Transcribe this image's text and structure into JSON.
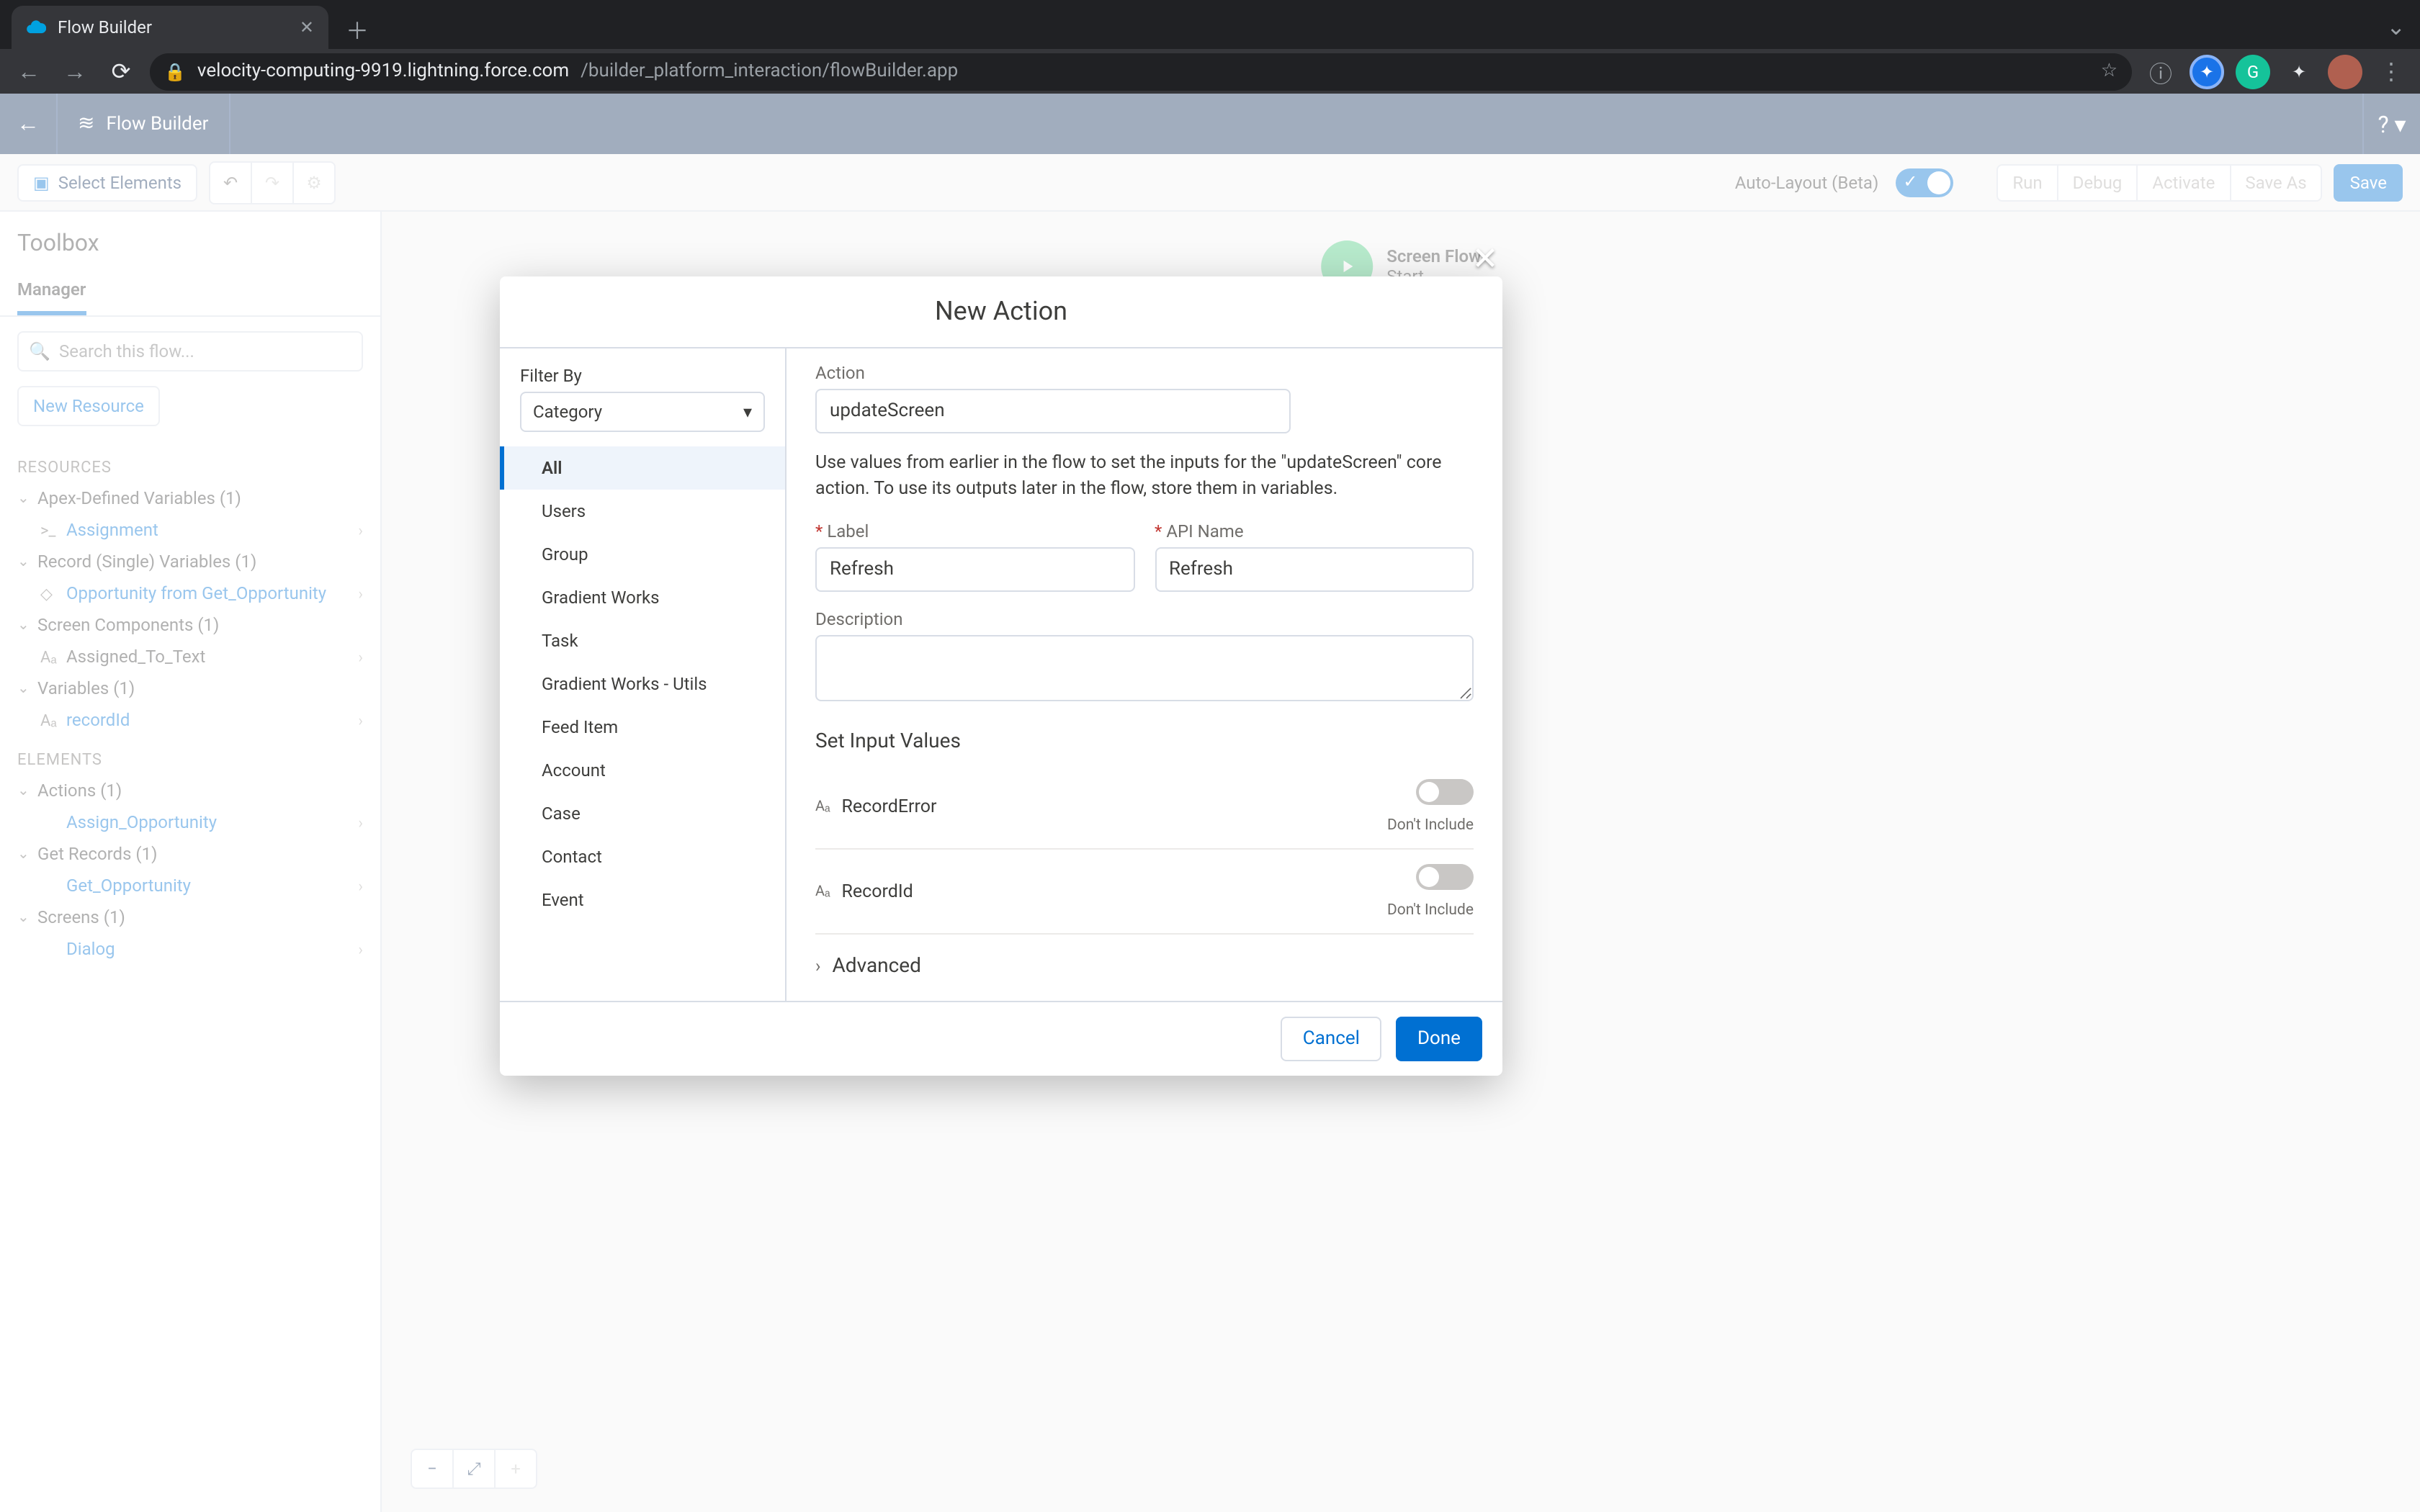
{
  "browser": {
    "tab_title": "Flow Builder",
    "url_secure_host": "velocity-computing-9919.lightning.force.com",
    "url_path": "/builder_platform_interaction/flowBuilder.app"
  },
  "header": {
    "app_title": "Flow Builder"
  },
  "toolbar": {
    "select_elements": "Select Elements",
    "auto_layout": "Auto-Layout (Beta)",
    "run": "Run",
    "debug": "Debug",
    "activate": "Activate",
    "save_as": "Save As",
    "save": "Save"
  },
  "sidebar": {
    "title": "Toolbox",
    "tab": "Manager",
    "search_placeholder": "Search this flow...",
    "new_resource": "New Resource",
    "sections": {
      "resources": "RESOURCES",
      "elements": "ELEMENTS"
    },
    "resources": {
      "apex_defined": "Apex-Defined Variables (1)",
      "apex_item": "Assignment",
      "record_single": "Record (Single) Variables (1)",
      "record_item": "Opportunity from Get_Opportunity",
      "screen_components": "Screen Components (1)",
      "screen_item": "Assigned_To_Text",
      "variables": "Variables (1)",
      "var_item": "recordId"
    },
    "elements": {
      "actions": "Actions (1)",
      "actions_item": "Assign_Opportunity",
      "get_records": "Get Records (1)",
      "get_records_item": "Get_Opportunity",
      "screens": "Screens (1)",
      "screens_item": "Dialog"
    }
  },
  "canvas": {
    "start_title": "Screen Flow",
    "start_sub": "Start"
  },
  "modal": {
    "title": "New Action",
    "filter_by": "Filter By",
    "filter_value": "Category",
    "categories": [
      "All",
      "Users",
      "Group",
      "Gradient Works",
      "Task",
      "Gradient Works - Utils",
      "Feed Item",
      "Account",
      "Case",
      "Contact",
      "Event"
    ],
    "action_label": "Action",
    "action_value": "updateScreen",
    "help_text": "Use values from earlier in the flow to set the inputs for the \"updateScreen\" core action. To use its outputs later in the flow, store them in variables.",
    "label_label": "Label",
    "label_value": "Refresh",
    "api_label": "API Name",
    "api_value": "Refresh",
    "desc_label": "Description",
    "set_inputs": "Set Input Values",
    "inputs": {
      "record_error": "RecordError",
      "record_id": "RecordId",
      "dont_include": "Don't Include"
    },
    "advanced": "Advanced",
    "cancel": "Cancel",
    "done": "Done"
  }
}
